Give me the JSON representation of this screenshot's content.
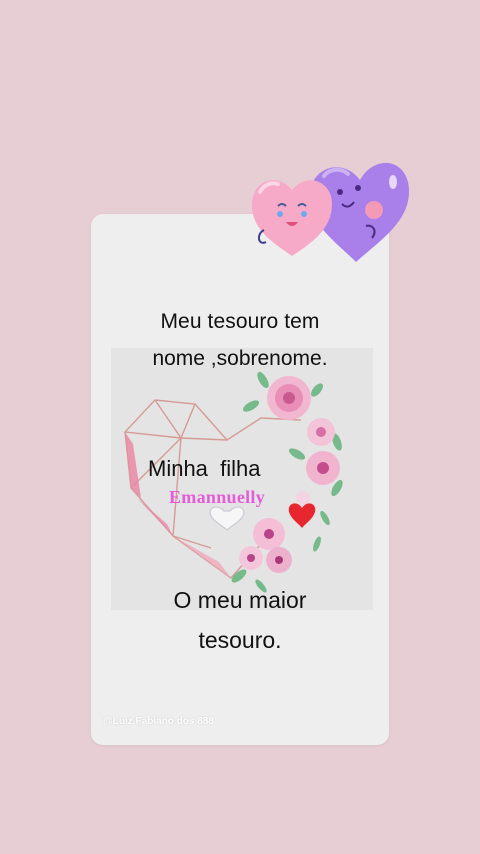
{
  "message": {
    "line1": "Meu tesouro tem",
    "line2": "nome ,sobrenome.",
    "line3": "O meu maior",
    "line4": "tesouro."
  },
  "picture": {
    "title": "Minha  filha",
    "name": "Emannuelly"
  },
  "watermark": "@Luiz Fabiano dos 888",
  "icons": {
    "sticker": "two-hearts-sticker-icon",
    "heart": "red-heart-icon"
  },
  "colors": {
    "background": "#e7cdd4",
    "card": "#eeeeef",
    "name": "#e55bd9"
  }
}
